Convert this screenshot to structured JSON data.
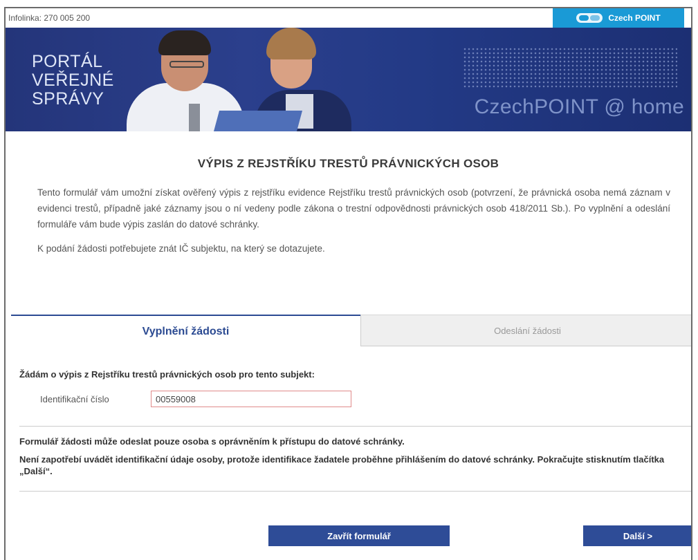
{
  "topbar": {
    "infolinka": "Infolinka: 270 005 200",
    "brand": "Czech POINT"
  },
  "banner": {
    "portal_line1": "PORTÁL",
    "portal_line2": "VEŘEJNÉ",
    "portal_line3": "SPRÁVY",
    "home": "CzechPOINT @ home"
  },
  "page": {
    "title": "VÝPIS Z REJSTŘÍKU TRESTŮ PRÁVNICKÝCH OSOB",
    "intro": "Tento formulář vám umožní získat ověřený výpis z rejstříku evidence Rejstříku trestů právnických osob (potvrzení, že právnická osoba nemá záznam v evidenci trestů, případně jaké záznamy jsou o ní vedeny podle zákona o trestní odpovědnosti právnických osob 418/2011 Sb.). Po vyplnění a odeslání formuláře vám bude výpis zaslán do datové schránky.",
    "intro2": "K podání žádosti potřebujete znát IČ subjektu, na který se dotazujete."
  },
  "tabs": {
    "active": "Vyplnění žádosti",
    "inactive": "Odeslání žádosti"
  },
  "form": {
    "request_label": "Žádám o výpis z Rejstříku trestů právnických osob pro tento subjekt:",
    "ic_label": "Identifikační číslo",
    "ic_value": "00559008",
    "note1": "Formulář žádosti může odeslat pouze osoba s oprávněním k přístupu do datové schránky.",
    "note2": "Není zapotřebí uvádět identifikační údaje osoby, protože identifikace žadatele proběhne přihlášením do datové schránky. Pokračujte stisknutím tlačítka „Další“."
  },
  "buttons": {
    "close": "Zavřít formulář",
    "next": "Další >"
  },
  "colors": {
    "brand_blue": "#2e4c97",
    "czechpoint_blue": "#1a9ad6",
    "banner_dark": "#24357a"
  }
}
